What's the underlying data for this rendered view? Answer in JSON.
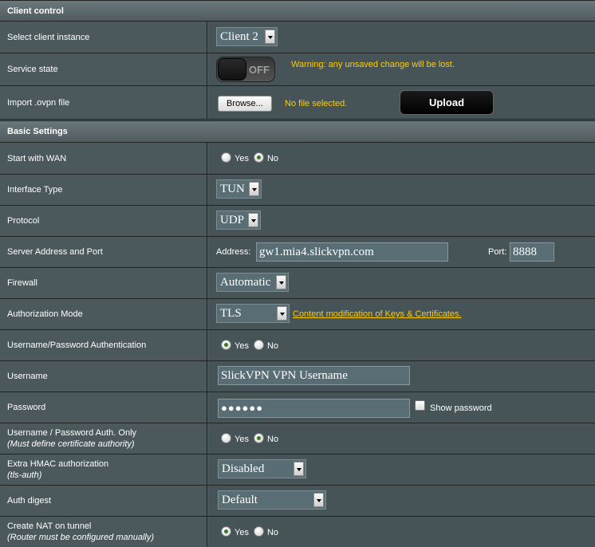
{
  "sections": {
    "client_control": "Client control",
    "basic_settings": "Basic Settings"
  },
  "client_control": {
    "select_client_instance": {
      "label": "Select client instance",
      "value": "Client 2"
    },
    "service_state": {
      "label": "Service state",
      "toggle": "OFF",
      "warning": "Warning: any unsaved change will be lost."
    },
    "import_ovpn": {
      "label": "Import .ovpn file",
      "browse": "Browse...",
      "file_status": "No file selected.",
      "upload": "Upload"
    }
  },
  "basic": {
    "start_with_wan": {
      "label": "Start with WAN",
      "yes": "Yes",
      "no": "No",
      "selected": "No"
    },
    "interface_type": {
      "label": "Interface Type",
      "value": "TUN"
    },
    "protocol": {
      "label": "Protocol",
      "value": "UDP"
    },
    "server": {
      "label": "Server Address and Port",
      "address_label": "Address:",
      "address": "gw1.mia4.slickvpn.com",
      "port_label": "Port:",
      "port": "8888"
    },
    "firewall": {
      "label": "Firewall",
      "value": "Automatic"
    },
    "auth_mode": {
      "label": "Authorization Mode",
      "value": "TLS",
      "link": "Content modification of Keys & Certificates."
    },
    "userpass_auth": {
      "label": "Username/Password Authentication",
      "yes": "Yes",
      "no": "No",
      "selected": "Yes"
    },
    "username": {
      "label": "Username",
      "value": "SlickVPN VPN Username"
    },
    "password": {
      "label": "Password",
      "value": "●●●●●●",
      "show_password": "Show password"
    },
    "userpass_only": {
      "label": "Username / Password Auth. Only",
      "note": "(Must define certificate authority)",
      "yes": "Yes",
      "no": "No",
      "selected": "No"
    },
    "extra_hmac": {
      "label": "Extra HMAC authorization",
      "note": "(tls-auth)",
      "value": "Disabled"
    },
    "auth_digest": {
      "label": "Auth digest",
      "value": "Default"
    },
    "create_nat": {
      "label": "Create NAT on tunnel",
      "note": "(Router must be configured manually)",
      "yes": "Yes",
      "no": "No",
      "selected": "Yes"
    }
  },
  "colors": {
    "background": "#4d595d",
    "warning": "#ffcc00",
    "header": "#5c686c"
  }
}
